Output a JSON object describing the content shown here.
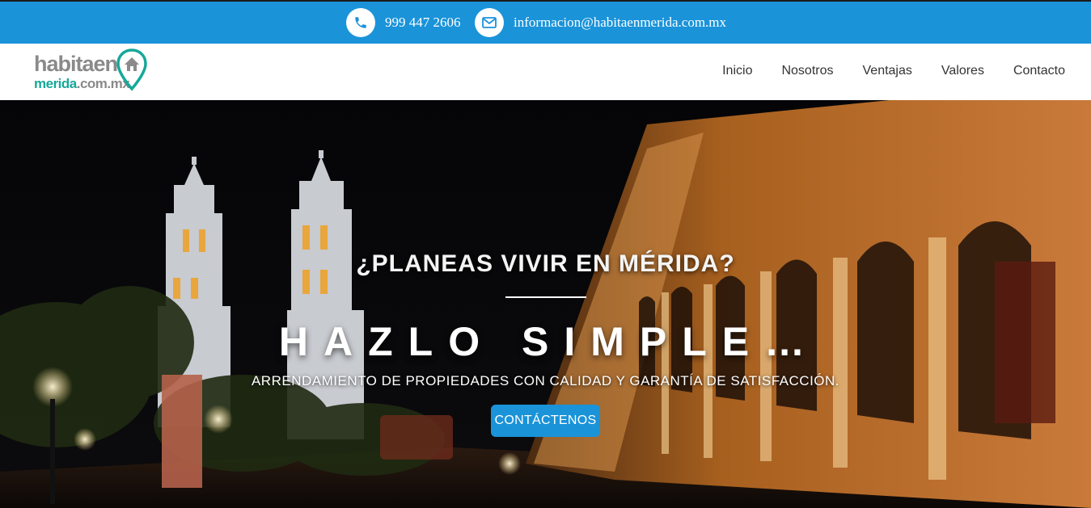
{
  "topbar": {
    "phone": "999 447 2606",
    "email": "informacion@habitaenmerida.com.mx",
    "phone_icon": "phone-icon",
    "email_icon": "envelope-icon",
    "background": "#1a93d9"
  },
  "logo": {
    "line1": "habitaen",
    "line2a": "merida",
    "line2b": ".com.mx",
    "icon": "house-pin-icon",
    "accent": "#16a89a"
  },
  "nav": {
    "items": [
      "Inicio",
      "Nosotros",
      "Ventajas",
      "Valores",
      "Contacto"
    ]
  },
  "hero": {
    "title": "¿PLANEAS VIVIR EN MÉRIDA?",
    "headline": "HAZLO SIMPLE…",
    "subtitle": "ARRENDAMIENTO DE PROPIEDADES CON CALIDAD Y GARANTÍA DE SATISFACCIÓN.",
    "button_label": "CONTÁCTENOS",
    "button_color": "#1a93d9"
  }
}
